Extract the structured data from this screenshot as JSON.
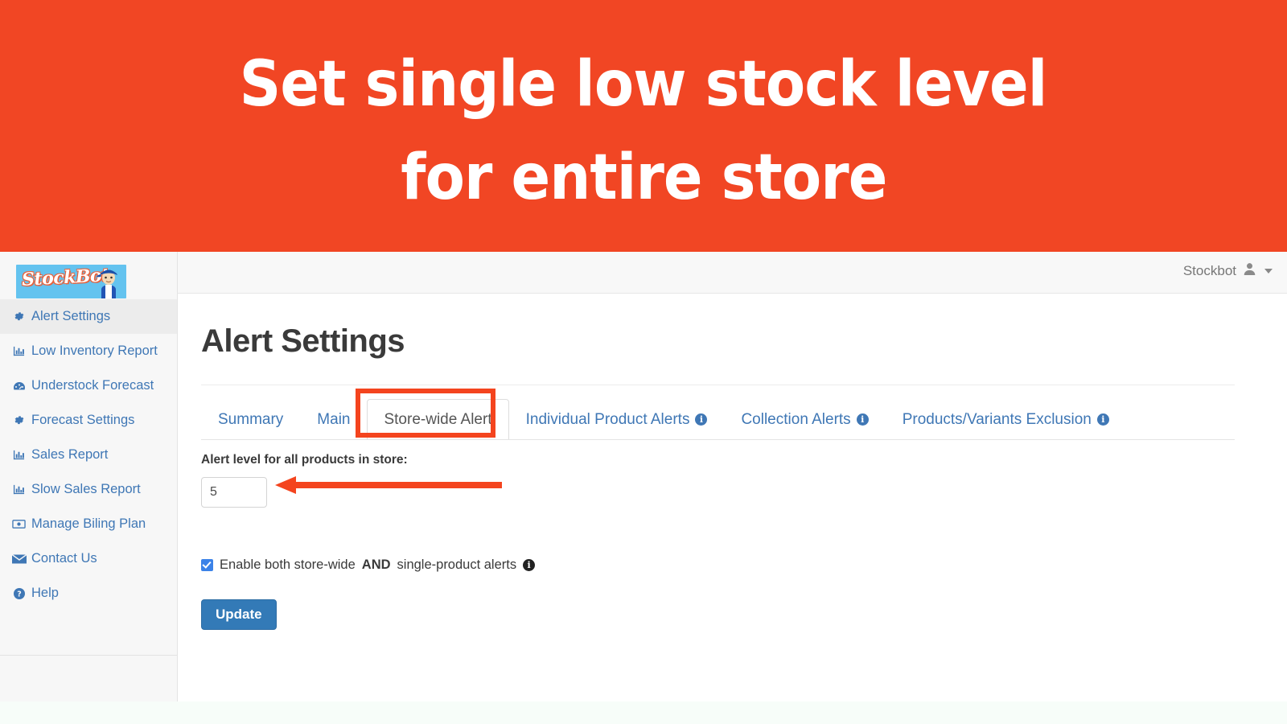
{
  "banner": {
    "line1": "Set single low stock level",
    "line2": "for entire store",
    "bg_color": "#f14624",
    "text_color": "#ffffff"
  },
  "topbar": {
    "account_label": "Stockbot",
    "account_icon": "user-icon",
    "caret_icon": "chevron-down-icon"
  },
  "sidebar": {
    "logo_text": "StockBot",
    "items": [
      {
        "label": "Alert Settings",
        "icon": "gear-icon",
        "active": true
      },
      {
        "label": "Low Inventory Report",
        "icon": "bar-chart-icon",
        "active": false
      },
      {
        "label": "Understock Forecast",
        "icon": "dashboard-icon",
        "active": false
      },
      {
        "label": "Forecast Settings",
        "icon": "gear-icon",
        "active": false
      },
      {
        "label": "Sales Report",
        "icon": "bar-chart-icon",
        "active": false
      },
      {
        "label": "Slow Sales Report",
        "icon": "bar-chart-icon",
        "active": false
      },
      {
        "label": "Manage Biling Plan",
        "icon": "money-bill-icon",
        "active": false
      },
      {
        "label": "Contact Us",
        "icon": "envelope-icon",
        "active": false
      },
      {
        "label": "Help",
        "icon": "question-circle-icon",
        "active": false
      }
    ]
  },
  "main": {
    "page_title": "Alert Settings",
    "tabs": [
      {
        "label": "Summary",
        "info": false,
        "active": false
      },
      {
        "label": "Main",
        "info": false,
        "active": false
      },
      {
        "label": "Store-wide Alert",
        "info": false,
        "active": true
      },
      {
        "label": "Individual Product Alerts",
        "info": true,
        "active": false
      },
      {
        "label": "Collection Alerts",
        "info": true,
        "active": false
      },
      {
        "label": "Products/Variants Exclusion",
        "info": true,
        "active": false
      }
    ],
    "form": {
      "alert_level_label": "Alert level for all products in store:",
      "alert_level_value": "5",
      "alert_level_placeholder": "",
      "checkbox_text_before": "Enable both store-wide ",
      "checkbox_text_bold": "AND",
      "checkbox_text_after": " single-product alerts",
      "checkbox_checked": true,
      "checkbox_info_icon": "info-icon",
      "update_label": "Update"
    }
  },
  "annotations": {
    "highlight_color": "#f4441e",
    "highlight_target": "Store-wide Alert",
    "arrow_direction": "left",
    "arrow_target": "alert-level-input"
  }
}
